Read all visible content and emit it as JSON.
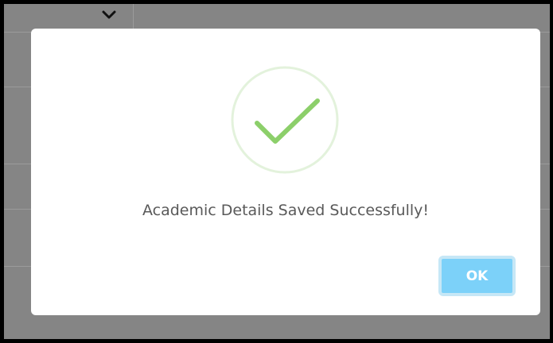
{
  "dialog": {
    "icon": "checkmark-circle-icon",
    "message": "Academic Details Saved Successfully!",
    "ok_label": "OK"
  },
  "colors": {
    "overlay": "#858585",
    "icon_ring": "#dff0d8",
    "icon_check": "#8ccf6a",
    "ok_button": "#7cd1f9",
    "message_text": "#595959"
  },
  "background": {
    "dropdown_icon": "chevron-down-icon"
  }
}
